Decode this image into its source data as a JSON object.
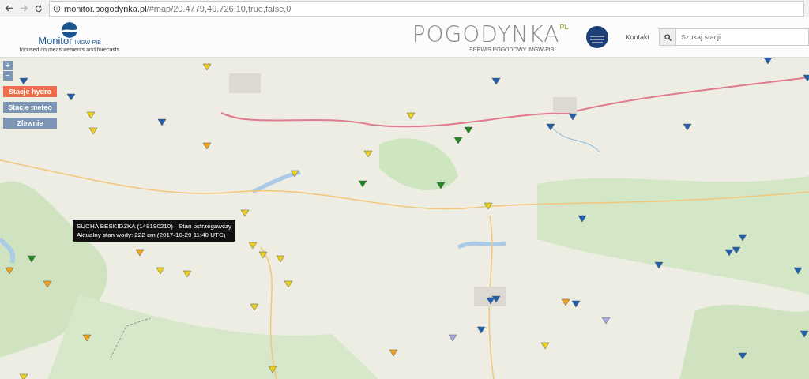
{
  "browser": {
    "url_host": "monitor.pogodynka.pl",
    "url_path": "/#map/20.4779,49.726,10,true,false,0"
  },
  "header": {
    "monitor_logo": {
      "name": "Monitor",
      "org": "IMGW-PIB",
      "tagline": "focused on measurements and forecasts"
    },
    "pogodynka_logo": {
      "name": "POGODYNKA",
      "suffix": "PL",
      "subtitle": "SERWIS POGODOWY IMGW-PIB"
    },
    "nav_link": "Kontakt",
    "search": {
      "placeholder": "Szukaj stacji"
    }
  },
  "map": {
    "zoom_in": "+",
    "zoom_out": "−",
    "layers": [
      {
        "label": "Stacje hydro",
        "selected": true
      },
      {
        "label": "Stacje meteo",
        "selected": false
      },
      {
        "label": "Zlewnie",
        "selected": false
      }
    ],
    "tooltip": {
      "line1": "SUCHA BESKIDZKA (149190210) - Stan ostrzegawczy",
      "line2": "Aktualny stan wody: 222 cm (2017-10-29 11:40 UTC)"
    }
  }
}
